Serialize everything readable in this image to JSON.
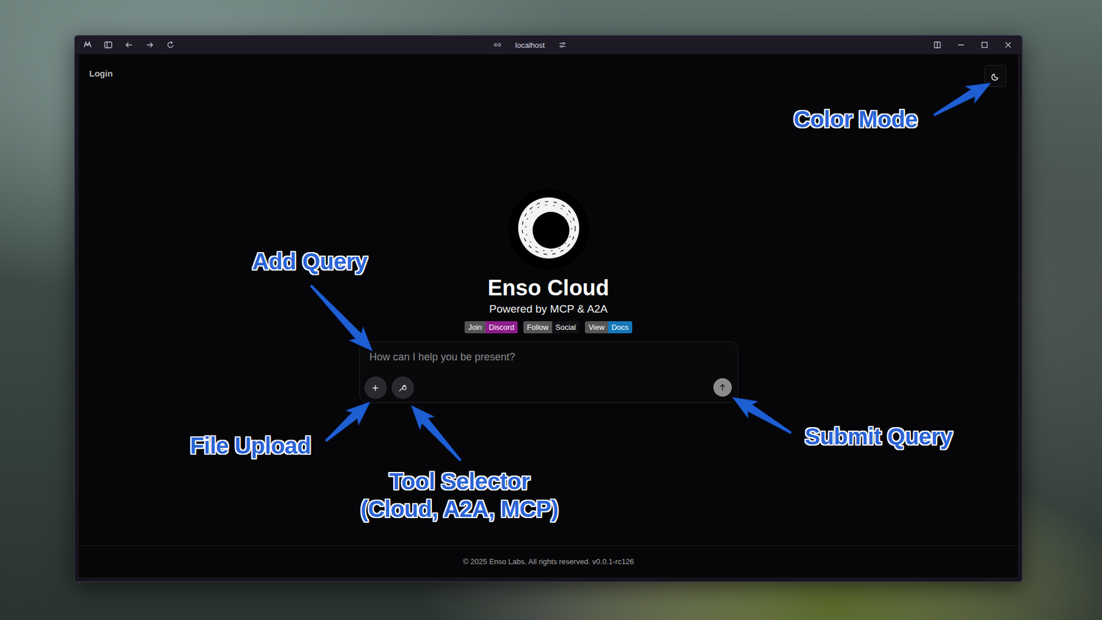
{
  "window": {
    "address": "localhost"
  },
  "page": {
    "login": "Login",
    "title": "Enso Cloud",
    "subtitle": "Powered by MCP & A2A",
    "badges": [
      {
        "left": "Join",
        "right": "Discord",
        "color": "#8e1c8c"
      },
      {
        "left": "Follow",
        "right": "Social",
        "color": "#111114"
      },
      {
        "left": "View",
        "right": "Docs",
        "color": "#1577b8"
      }
    ],
    "prompt": {
      "placeholder": "How can I help you be present?"
    },
    "footer": "© 2025 Enso Labs. All rights reserved. v0.0.1-rc126"
  },
  "annotations": [
    {
      "label": "Color Mode",
      "detail": ""
    },
    {
      "label": "Add Query",
      "detail": ""
    },
    {
      "label": "File Upload",
      "detail": ""
    },
    {
      "label": "Tool Selector",
      "detail": "(Cloud, A2A, MCP)"
    },
    {
      "label": "Submit Query",
      "detail": ""
    }
  ]
}
